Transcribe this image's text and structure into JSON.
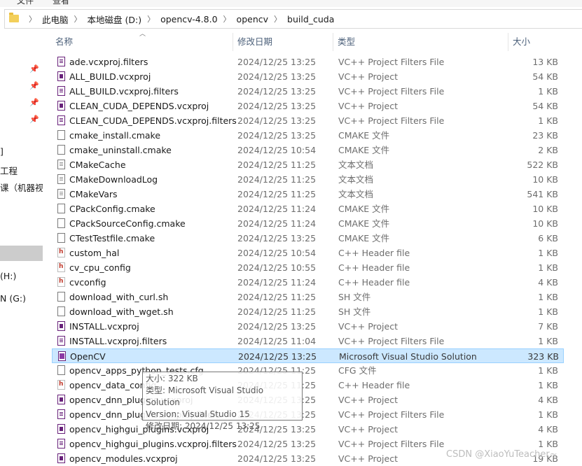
{
  "top_menu": [
    "文件",
    "查看"
  ],
  "address": {
    "folder_icon": "folder-icon",
    "crumbs": [
      "此电脑",
      "本地磁盘 (D:)",
      "opencv-4.8.0",
      "opencv",
      "build_cuda"
    ]
  },
  "sidebar": {
    "texts": [
      "]",
      "工程",
      "课（机器视觉",
      "(H:)",
      "N (G:)"
    ]
  },
  "columns": {
    "name": "名称",
    "date": "修改日期",
    "type": "类型",
    "size": "大小"
  },
  "files": [
    {
      "name": "ade.vcxproj.filters",
      "date": "2024/12/25 13:25",
      "type": "VC++ Project Filters File",
      "size": "13 KB",
      "icon": "filt"
    },
    {
      "name": "ALL_BUILD.vcxproj",
      "date": "2024/12/25 13:25",
      "type": "VC++ Project",
      "size": "54 KB",
      "icon": "vc"
    },
    {
      "name": "ALL_BUILD.vcxproj.filters",
      "date": "2024/12/25 13:25",
      "type": "VC++ Project Filters File",
      "size": "1 KB",
      "icon": "filt"
    },
    {
      "name": "CLEAN_CUDA_DEPENDS.vcxproj",
      "date": "2024/12/25 13:25",
      "type": "VC++ Project",
      "size": "54 KB",
      "icon": "vc"
    },
    {
      "name": "CLEAN_CUDA_DEPENDS.vcxproj.filters",
      "date": "2024/12/25 13:25",
      "type": "VC++ Project Filters File",
      "size": "1 KB",
      "icon": "filt"
    },
    {
      "name": "cmake_install.cmake",
      "date": "2024/12/25 13:25",
      "type": "CMAKE 文件",
      "size": "23 KB",
      "icon": "blank"
    },
    {
      "name": "cmake_uninstall.cmake",
      "date": "2024/12/25 10:54",
      "type": "CMAKE 文件",
      "size": "2 KB",
      "icon": "blank"
    },
    {
      "name": "CMakeCache",
      "date": "2024/12/25 11:25",
      "type": "文本文档",
      "size": "522 KB",
      "icon": "txt"
    },
    {
      "name": "CMakeDownloadLog",
      "date": "2024/12/25 11:25",
      "type": "文本文档",
      "size": "10 KB",
      "icon": "txt"
    },
    {
      "name": "CMakeVars",
      "date": "2024/12/25 11:25",
      "type": "文本文档",
      "size": "541 KB",
      "icon": "txt"
    },
    {
      "name": "CPackConfig.cmake",
      "date": "2024/12/25 11:24",
      "type": "CMAKE 文件",
      "size": "10 KB",
      "icon": "blank"
    },
    {
      "name": "CPackSourceConfig.cmake",
      "date": "2024/12/25 11:24",
      "type": "CMAKE 文件",
      "size": "10 KB",
      "icon": "blank"
    },
    {
      "name": "CTestTestfile.cmake",
      "date": "2024/12/25 13:25",
      "type": "CMAKE 文件",
      "size": "6 KB",
      "icon": "blank"
    },
    {
      "name": "custom_hal",
      "date": "2024/12/25 10:54",
      "type": "C++ Header file",
      "size": "1 KB",
      "icon": "hdr"
    },
    {
      "name": "cv_cpu_config",
      "date": "2024/12/25 10:55",
      "type": "C++ Header file",
      "size": "1 KB",
      "icon": "hdr"
    },
    {
      "name": "cvconfig",
      "date": "2024/12/25 11:24",
      "type": "C++ Header file",
      "size": "4 KB",
      "icon": "hdr"
    },
    {
      "name": "download_with_curl.sh",
      "date": "2024/12/25 11:25",
      "type": "SH 文件",
      "size": "1 KB",
      "icon": "blank"
    },
    {
      "name": "download_with_wget.sh",
      "date": "2024/12/25 11:25",
      "type": "SH 文件",
      "size": "1 KB",
      "icon": "blank"
    },
    {
      "name": "INSTALL.vcxproj",
      "date": "2024/12/25 13:25",
      "type": "VC++ Project",
      "size": "7 KB",
      "icon": "vc"
    },
    {
      "name": "INSTALL.vcxproj.filters",
      "date": "2024/12/25 11:04",
      "type": "VC++ Project Filters File",
      "size": "1 KB",
      "icon": "filt"
    },
    {
      "name": "OpenCV",
      "date": "2024/12/25 13:25",
      "type": "Microsoft Visual Studio Solution",
      "size": "323 KB",
      "icon": "sln",
      "selected": true
    },
    {
      "name": "opencv_apps_python_tests.cfg",
      "date": "2024/12/25 11:25",
      "type": "CFG 文件",
      "size": "1 KB",
      "icon": "blank"
    },
    {
      "name": "opencv_data_config",
      "date": "2024/12/25 11:25",
      "type": "C++ Header file",
      "size": "1 KB",
      "icon": "hdr"
    },
    {
      "name": "opencv_dnn_plugins.vcxproj",
      "date": "2024/12/25 13:25",
      "type": "VC++ Project",
      "size": "4 KB",
      "icon": "vc"
    },
    {
      "name": "opencv_dnn_plugins.vcxproj.filters",
      "date": "2024/12/25 13:25",
      "type": "VC++ Project Filters File",
      "size": "1 KB",
      "icon": "filt"
    },
    {
      "name": "opencv_highgui_plugins.vcxproj",
      "date": "2024/12/25 13:25",
      "type": "VC++ Project",
      "size": "4 KB",
      "icon": "vc"
    },
    {
      "name": "opencv_highgui_plugins.vcxproj.filters",
      "date": "2024/12/25 13:25",
      "type": "VC++ Project Filters File",
      "size": "1 KB",
      "icon": "filt"
    },
    {
      "name": "opencv_modules.vcxproj",
      "date": "2024/12/25 13:25",
      "type": "VC++ Project",
      "size": "19 KB",
      "icon": "vc"
    }
  ],
  "tooltip": {
    "size": "大小: 322 KB",
    "type": "类型: Microsoft Visual Studio Solution",
    "version": "Version: Visual Studio 15",
    "modified": "修改日期: 2024/12/25 13:25"
  },
  "watermark": "CSDN @XiaoYuTeacher~",
  "colors": {
    "selection_bg": "#cce8ff",
    "selection_border": "#99d1ff",
    "header_text": "#4c607a"
  }
}
